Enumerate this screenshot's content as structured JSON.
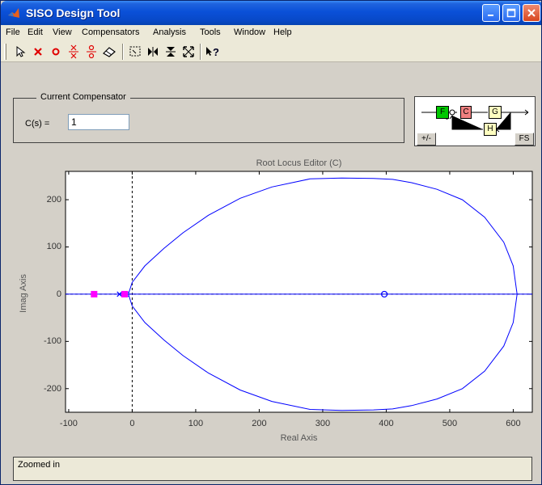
{
  "window": {
    "title": "SISO Design Tool"
  },
  "menu": [
    "File",
    "Edit",
    "View",
    "Compensators",
    "Analysis",
    "Tools",
    "Window",
    "Help"
  ],
  "compensator": {
    "frame_label": "Current Compensator",
    "label": "C(s) =",
    "value": "1"
  },
  "diagram": {
    "blocks": {
      "F": "F",
      "C": "C",
      "G": "G",
      "H": "H"
    },
    "sign_button": "+/-",
    "sign_minus": "-",
    "fs_button": "FS"
  },
  "editor": {
    "title": "Root Locus Editor (C)"
  },
  "status": {
    "text": "Zoomed in"
  },
  "chart_data": {
    "type": "line",
    "xlabel": "Real Axis",
    "ylabel": "Imag Axis",
    "xlim": [
      -105,
      630
    ],
    "ylim": [
      -250,
      260
    ],
    "xticks": [
      -100,
      0,
      100,
      200,
      300,
      400,
      500,
      600
    ],
    "yticks": [
      -200,
      -100,
      0,
      100,
      200
    ],
    "series": [
      {
        "x": [
          -6,
          0,
          20,
          50,
          80,
          120,
          170,
          220,
          280,
          330,
          380,
          410,
          440,
          480,
          520,
          555,
          585,
          600,
          606
        ],
        "y": [
          0,
          25,
          60,
          97,
          130,
          167,
          203,
          227,
          244,
          246,
          245,
          243,
          236,
          222,
          200,
          163,
          110,
          60,
          0
        ]
      },
      {
        "x": [
          -6,
          0,
          20,
          50,
          80,
          120,
          170,
          220,
          280,
          330,
          380,
          410,
          440,
          480,
          520,
          555,
          585,
          600,
          606
        ],
        "y": [
          0,
          -25,
          -60,
          -97,
          -130,
          -167,
          -203,
          -227,
          -244,
          -246,
          -245,
          -243,
          -236,
          -222,
          -200,
          -163,
          -110,
          -60,
          0
        ]
      },
      {
        "x": [
          -105,
          630
        ],
        "y": [
          0,
          0
        ]
      }
    ],
    "poles": [
      -20,
      -10
    ],
    "zeros": [
      397
    ],
    "closed_loop_poles": [
      -60,
      -12
    ],
    "colors": {
      "locus": "#0000ff",
      "closed_loop_poles": "#ff00ff"
    },
    "grid": false,
    "reference_lines": "dashed at x=0 and y=0"
  }
}
